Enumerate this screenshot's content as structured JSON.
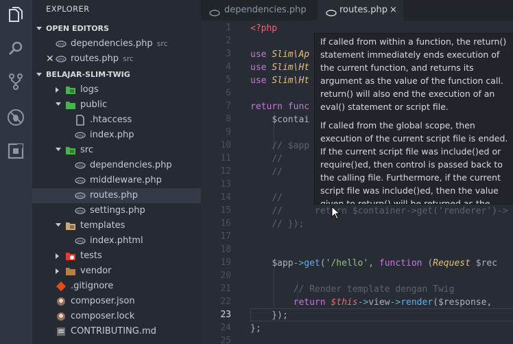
{
  "sidebar": {
    "title": "EXPLORER",
    "open_editors": {
      "label": "OPEN EDITORS",
      "items": [
        {
          "name": "dependencies.php",
          "path": "src",
          "closable": false
        },
        {
          "name": "routes.php",
          "path": "src",
          "closable": true
        }
      ]
    },
    "project": {
      "label": "BELAJAR-SLIM-TWIG",
      "tree": [
        {
          "name": "logs",
          "kind": "folder",
          "open": false
        },
        {
          "name": "public",
          "kind": "folder",
          "open": true
        },
        {
          "name": ".htaccess",
          "kind": "file"
        },
        {
          "name": "index.php",
          "kind": "file"
        },
        {
          "name": "src",
          "kind": "folder",
          "open": true
        },
        {
          "name": "dependencies.php",
          "kind": "file"
        },
        {
          "name": "middleware.php",
          "kind": "file"
        },
        {
          "name": "routes.php",
          "kind": "file",
          "selected": true
        },
        {
          "name": "settings.php",
          "kind": "file"
        },
        {
          "name": "templates",
          "kind": "folder",
          "open": true
        },
        {
          "name": "index.phtml",
          "kind": "file"
        },
        {
          "name": "tests",
          "kind": "folder",
          "open": false
        },
        {
          "name": "vendor",
          "kind": "folder",
          "open": false
        },
        {
          "name": ".gitignore",
          "kind": "file"
        },
        {
          "name": "composer.json",
          "kind": "file"
        },
        {
          "name": "composer.lock",
          "kind": "file"
        },
        {
          "name": "CONTRIBUTING.md",
          "kind": "file"
        }
      ]
    }
  },
  "tabs": [
    {
      "label": "dependencies.php",
      "active": false
    },
    {
      "label": "routes.php",
      "active": true,
      "close": "×"
    }
  ],
  "editor": {
    "line_numbers": [
      "1",
      "2",
      "3",
      "4",
      "5",
      "6",
      "7",
      "8",
      "9",
      "10",
      "11",
      "12",
      "13",
      "14",
      "15",
      "16",
      "17",
      "18",
      "19",
      "20",
      "21",
      "22",
      "23",
      "24",
      "25"
    ],
    "current_line": "23"
  },
  "hover": {
    "p1": "If called from within a function, the return() statement immediately ends execution of the current function, and returns its argument as the value of the function call. return() will also end the execution of an eval() statement or script file.",
    "p2": "If called from the global scope, then execution of the current script file is ended. If the current script file was include()ed or require()ed, then control is passed back to the calling file. Furthermore, if the current script file was include()ed, then the value given to return() will be returned as the value of the include() call. If return() is called from within the main script file, then script execution ends. If the current script file was named by the auto_prepend_file or auto_append_file configuration options in php.ini, then that script file's execution is ended."
  },
  "colors": {
    "accent": "#61afef",
    "keyword": "#c678dd",
    "string": "#98c379",
    "comment": "#5c6370",
    "variable": "#e06c75"
  }
}
